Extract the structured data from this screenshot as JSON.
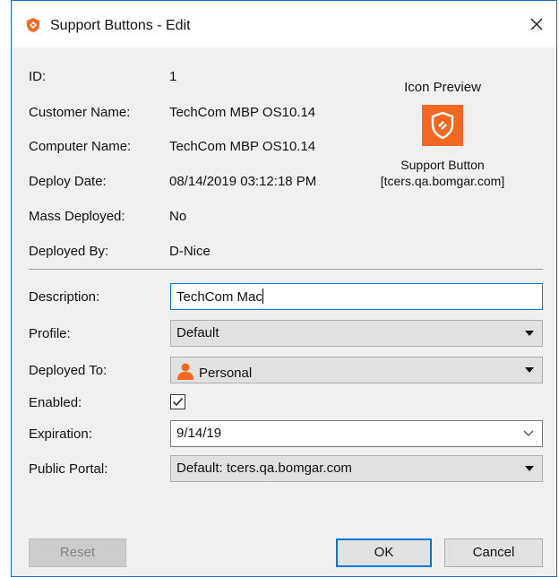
{
  "window": {
    "title": "Support Buttons - Edit"
  },
  "info": {
    "id_label": "ID:",
    "id_value": "1",
    "customer_label": "Customer Name:",
    "customer_value": "TechCom MBP OS10.14",
    "computer_label": "Computer Name:",
    "computer_value": "TechCom MBP OS10.14",
    "deploy_date_label": "Deploy Date:",
    "deploy_date_value": "08/14/2019 03:12:18 PM",
    "mass_label": "Mass Deployed:",
    "mass_value": "No",
    "deployed_by_label": "Deployed By:",
    "deployed_by_value": "D-Nice"
  },
  "preview": {
    "heading": "Icon Preview",
    "name_line1": "Support Button",
    "name_line2": "[tcers.qa.bomgar.com]",
    "icon": "support-button-shield-icon",
    "icon_color": "#f26722"
  },
  "form": {
    "description_label": "Description:",
    "description_value": "TechCom Mac",
    "profile_label": "Profile:",
    "profile_value": "Default",
    "deployed_to_label": "Deployed To:",
    "deployed_to_value": "Personal",
    "enabled_label": "Enabled:",
    "enabled": true,
    "expiration_label": "Expiration:",
    "expiration_value": "9/14/19",
    "portal_label": "Public Portal:",
    "portal_value": "Default: tcers.qa.bomgar.com"
  },
  "buttons": {
    "reset": "Reset",
    "ok": "OK",
    "cancel": "Cancel"
  },
  "colors": {
    "accent": "#0078d7",
    "brand_orange": "#f26722"
  }
}
